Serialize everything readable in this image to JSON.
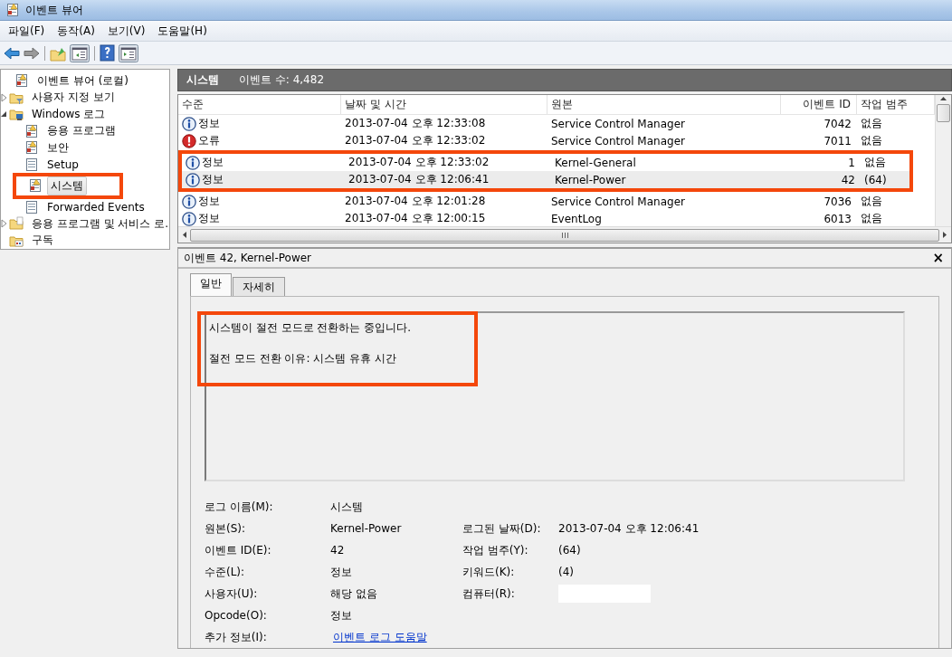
{
  "window": {
    "title": "이벤트 뷰어"
  },
  "menu": [
    "파일(F)",
    "동작(A)",
    "보기(V)",
    "도움말(H)"
  ],
  "toolbar": [
    {
      "kind": "back"
    },
    {
      "kind": "forward"
    },
    {
      "kind": "separator"
    },
    {
      "kind": "folder-up"
    },
    {
      "kind": "pane-left"
    },
    {
      "kind": "separator"
    },
    {
      "kind": "help"
    },
    {
      "kind": "pane-right"
    }
  ],
  "tree": [
    {
      "label": "이벤트 뷰어 (로컬)",
      "kind": "viewer",
      "selected": false,
      "highlighted": false,
      "children": [
        {
          "label": "사용자 지정 보기",
          "kind": "filter-folder",
          "expanded": false,
          "selected": false,
          "highlighted": false
        },
        {
          "label": "Windows 로그",
          "kind": "windows-folder",
          "expanded": true,
          "selected": false,
          "highlighted": false,
          "children": [
            {
              "label": "응용 프로그램",
              "kind": "log",
              "selected": false,
              "highlighted": false
            },
            {
              "label": "보안",
              "kind": "log",
              "selected": false,
              "highlighted": false
            },
            {
              "label": "Setup",
              "kind": "plain-log",
              "selected": false,
              "highlighted": false
            },
            {
              "label": "시스템",
              "kind": "log",
              "selected": true,
              "highlighted": true
            },
            {
              "label": "Forwarded Events",
              "kind": "plain-log",
              "selected": false,
              "highlighted": false
            }
          ]
        },
        {
          "label": "응용 프로그램 및 서비스 로.",
          "kind": "folder",
          "expanded": false,
          "selected": false,
          "highlighted": false
        },
        {
          "label": "구독",
          "kind": "subscription",
          "selected": false,
          "highlighted": false
        }
      ]
    }
  ],
  "header": {
    "title": "시스템",
    "count": "이벤트 수: 4,482"
  },
  "table": {
    "columns": [
      "수준",
      "날짜 및 시간",
      "원본",
      "이벤트 ID",
      "작업 범주"
    ],
    "rows": [
      {
        "kind": "info",
        "level": "정보",
        "date": "2013-07-04 오후 12:33:08",
        "source": "Service Control Manager",
        "event_id": "7042",
        "category": "없음",
        "selected": false,
        "highlighted": false
      },
      {
        "kind": "error",
        "level": "오류",
        "date": "2013-07-04 오후 12:33:02",
        "source": "Service Control Manager",
        "event_id": "7011",
        "category": "없음",
        "selected": false,
        "highlighted": false
      },
      {
        "kind": "info",
        "level": "정보",
        "date": "2013-07-04 오후 12:33:02",
        "source": "Kernel-General",
        "event_id": "1",
        "category": "없음",
        "selected": false,
        "highlighted": true
      },
      {
        "kind": "info",
        "level": "정보",
        "date": "2013-07-04 오후 12:06:41",
        "source": "Kernel-Power",
        "event_id": "42",
        "category": "(64)",
        "selected": true,
        "highlighted": true
      },
      {
        "kind": "info",
        "level": "정보",
        "date": "2013-07-04 오후 12:01:28",
        "source": "Service Control Manager",
        "event_id": "7036",
        "category": "없음",
        "selected": false,
        "highlighted": false
      },
      {
        "kind": "info",
        "level": "정보",
        "date": "2013-07-04 오후 12:00:15",
        "source": "EventLog",
        "event_id": "6013",
        "category": "없음",
        "selected": false,
        "highlighted": false
      }
    ]
  },
  "detail": {
    "title": "이벤트 42, Kernel-Power",
    "close": "×",
    "tabs": [
      {
        "label": "일반",
        "selected": true
      },
      {
        "label": "자세히",
        "selected": false
      }
    ],
    "description": [
      "시스템이 절전 모드로 전환하는 중입니다.",
      "절전 모드 전환 이유: 시스템 유휴 시간"
    ],
    "description_highlighted": true,
    "fields": [
      [
        {
          "label": "로그 이름(M):",
          "value": "시스템",
          "kind": "text"
        }
      ],
      [
        {
          "label": "원본(S):",
          "value": "Kernel-Power",
          "kind": "text"
        },
        {
          "label": "로그된 날짜(D):",
          "value": "2013-07-04 오후 12:06:41",
          "kind": "text"
        }
      ],
      [
        {
          "label": "이벤트 ID(E):",
          "value": "42",
          "kind": "text"
        },
        {
          "label": "작업 범주(Y):",
          "value": "(64)",
          "kind": "text"
        }
      ],
      [
        {
          "label": "수준(L):",
          "value": "정보",
          "kind": "text"
        },
        {
          "label": "키워드(K):",
          "value": "(4)",
          "kind": "text"
        }
      ],
      [
        {
          "label": "사용자(U):",
          "value": "해당 없음",
          "kind": "text"
        },
        {
          "label": "컴퓨터(R):",
          "kind": "redacted"
        }
      ],
      [
        {
          "label": "Opcode(O):",
          "value": "정보",
          "kind": "text"
        }
      ],
      [
        {
          "label": "추가 정보(I):",
          "value": "이벤트 로그 도움말",
          "kind": "link"
        }
      ]
    ]
  }
}
